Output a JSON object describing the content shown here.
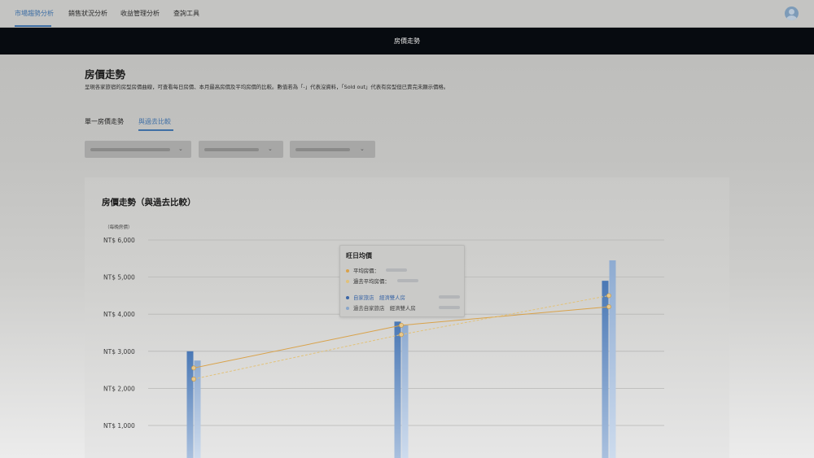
{
  "nav": {
    "items": [
      {
        "label": "市場趨勢分析",
        "active": true
      },
      {
        "label": "銷售狀況分析",
        "active": false
      },
      {
        "label": "收益管理分析",
        "active": false
      },
      {
        "label": "查詢工具",
        "active": false
      }
    ]
  },
  "titlebar": {
    "title": "房價走勢"
  },
  "page": {
    "title": "房價走勢",
    "description": "呈現各家旅宿的房型房價曲線，可查看每日房價、本月最高房價及平均房價的比較。數值若為「-」代表沒資料，「Sold out」代表有房型但已賣完未顯示價格。"
  },
  "tabs": [
    {
      "label": "單一房價走勢",
      "active": false
    },
    {
      "label": "與過去比較",
      "active": true
    }
  ],
  "filters": [
    "",
    "",
    ""
  ],
  "chart": {
    "title": "房價走勢（與過去比較）",
    "y_unit": "（每晚房價）"
  },
  "tooltip": {
    "title": "旺日均價",
    "rows": [
      {
        "label": "平均房價：",
        "color": "#d9a24a"
      },
      {
        "label": "過去平均房價：",
        "color": "#e2c27a"
      },
      {
        "label": "自家旅店　經濟雙人房",
        "color": "#3b66a6"
      },
      {
        "label": "過去自家旅店　經濟雙人房",
        "color": "#8aa6c9"
      }
    ]
  },
  "colors": {
    "accent": "#3f6fa5",
    "bar_current": "#4a78b5",
    "bar_past": "#93aed0",
    "avg_line": "#d9a24a",
    "past_avg_line": "#e2c27a",
    "titlebar_bg": "#070b10"
  },
  "chart_data": {
    "type": "bar",
    "y_tick_labels": [
      "NT$ 6,000",
      "NT$ 5,000",
      "NT$ 4,000",
      "NT$ 3,000",
      "NT$ 2,000",
      "NT$ 1,000"
    ],
    "y_ticks": [
      6000,
      5000,
      4000,
      3000,
      2000,
      1000
    ],
    "ylim": [
      0,
      6000
    ],
    "grid": true,
    "categories": [
      "",
      "",
      ""
    ],
    "series": [
      {
        "name": "自家旅店　經濟雙人房",
        "kind": "bar",
        "values": [
          3000,
          3800,
          4900
        ]
      },
      {
        "name": "過去自家旅店　經濟雙人房",
        "kind": "bar",
        "values": [
          2750,
          3700,
          5450
        ]
      },
      {
        "name": "平均房價",
        "kind": "line",
        "values": [
          2550,
          3700,
          4200
        ]
      },
      {
        "name": "過去平均房價",
        "kind": "line",
        "values": [
          2250,
          3450,
          4500
        ]
      }
    ]
  }
}
